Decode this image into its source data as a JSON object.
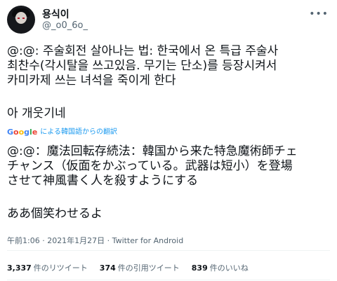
{
  "author": {
    "name": "용식이",
    "handle": "@_o0_6o_"
  },
  "tweet": {
    "original_text": "@:@: 주술회전 살아나는 법: 한국에서 온 특급 주술사\n최찬수(각시탈을 쓰고있음. 무기는 단소)를 등장시켜서\n카미카제 쓰는 녀석을 죽이게 한다",
    "reply_text": "아 개웃기네",
    "translation_label": "による韓国語からの翻訳",
    "google_letters": [
      "G",
      "o",
      "o",
      "g",
      "l",
      "e"
    ],
    "translated_text": "@:@：魔法回転存続法：韓国から来た特急魔術師チェ\nチャンス（仮面をかぶっている。武器は短小）を登場\nさせて神風書く人を殺すようにする",
    "translated_reply": "ああ個笑わせるよ",
    "meta": "午前1:06 · 2021年1月27日 · Twitter for Android"
  },
  "stats": {
    "retweets_count": "3,337",
    "retweets_label": "件のリツイート",
    "quotes_count": "374",
    "quotes_label": "件の引用ツイート",
    "likes_count": "839",
    "likes_label": "件のいいね"
  },
  "icons": {
    "more": "more-horizontal-icon",
    "avatar": "avatar-image"
  },
  "colors": {
    "text": "#0f1419",
    "secondary": "#536471",
    "link": "#1d9bf0"
  }
}
